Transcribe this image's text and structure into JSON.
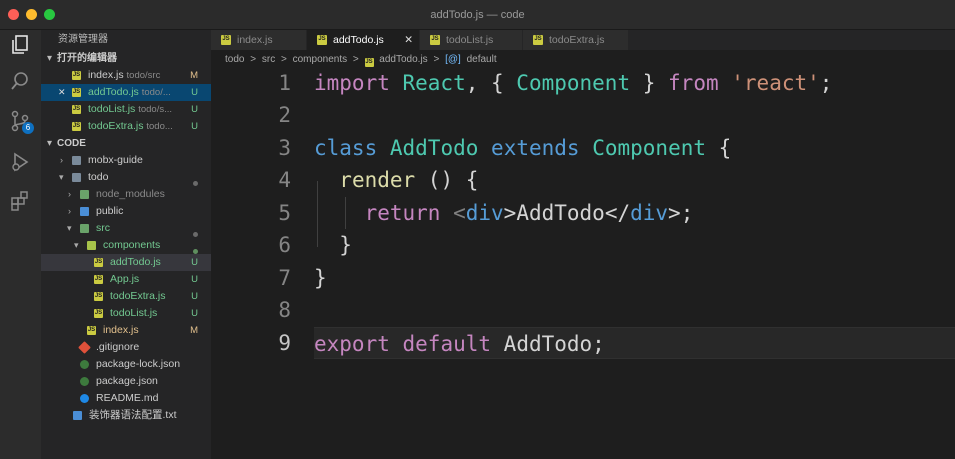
{
  "window": {
    "title": "addTodo.js — code"
  },
  "activity_bar": {
    "icons": [
      "files-icon",
      "search-icon",
      "source-control-icon",
      "debug-icon",
      "extensions-icon"
    ],
    "scm_badge": "6"
  },
  "sidebar": {
    "header": "资源管理器",
    "open_editors_label": "打开的编辑器",
    "open_editors": [
      {
        "name": "index.js",
        "path": "todo/src",
        "status": "M",
        "close": ""
      },
      {
        "name": "addTodo.js",
        "path": "todo/...",
        "status": "U",
        "close": "✕"
      },
      {
        "name": "todoList.js",
        "path": "todo/s...",
        "status": "U",
        "close": ""
      },
      {
        "name": "todoExtra.js",
        "path": "todo...",
        "status": "U",
        "close": ""
      }
    ],
    "workspace_label": "CODE",
    "tree": [
      {
        "name": "mobx-guide",
        "status": ""
      },
      {
        "name": "todo",
        "status": ""
      },
      {
        "name": "node_modules",
        "status": ""
      },
      {
        "name": "public",
        "status": ""
      },
      {
        "name": "src",
        "status": ""
      },
      {
        "name": "components",
        "status": ""
      },
      {
        "name": "addTodo.js",
        "status": "U"
      },
      {
        "name": "App.js",
        "status": "U"
      },
      {
        "name": "todoExtra.js",
        "status": "U"
      },
      {
        "name": "todoList.js",
        "status": "U"
      },
      {
        "name": "index.js",
        "status": "M"
      },
      {
        "name": ".gitignore",
        "status": ""
      },
      {
        "name": "package-lock.json",
        "status": ""
      },
      {
        "name": "package.json",
        "status": ""
      },
      {
        "name": "README.md",
        "status": ""
      },
      {
        "name": "装饰器语法配置.txt",
        "status": ""
      }
    ]
  },
  "tabs": [
    {
      "label": "index.js"
    },
    {
      "label": "addTodo.js",
      "close": "✕"
    },
    {
      "label": "todoList.js"
    },
    {
      "label": "todoExtra.js"
    }
  ],
  "breadcrumb": [
    "todo",
    ">",
    "src",
    ">",
    "components",
    ">",
    "addTodo.js",
    ">",
    "[@]",
    "default"
  ],
  "code": {
    "line_numbers": [
      "1",
      "2",
      "3",
      "4",
      "5",
      "6",
      "7",
      "8",
      "9"
    ],
    "l1": {
      "a": "import",
      "b": " React",
      "c": ", { ",
      "d": "Component",
      "e": " } ",
      "f": "from",
      "g": " ",
      "h": "'react'",
      "i": ";"
    },
    "l3": {
      "a": "class",
      "b": " ",
      "c": "AddTodo",
      "d": " ",
      "e": "extends",
      "f": " ",
      "g": "Component",
      "h": " {"
    },
    "l4": {
      "a": "  ",
      "b": "render",
      "c": " () {"
    },
    "l5": {
      "a": "    ",
      "b": "return",
      "c": " <",
      "d": "div",
      "e": ">AddTodo</",
      "f": "div",
      "g": ">;"
    },
    "l6": {
      "a": "  }"
    },
    "l7": {
      "a": "}"
    },
    "l9": {
      "a": "export",
      "b": " ",
      "c": "default",
      "d": " AddTodo;"
    }
  },
  "text_cursor": "I"
}
